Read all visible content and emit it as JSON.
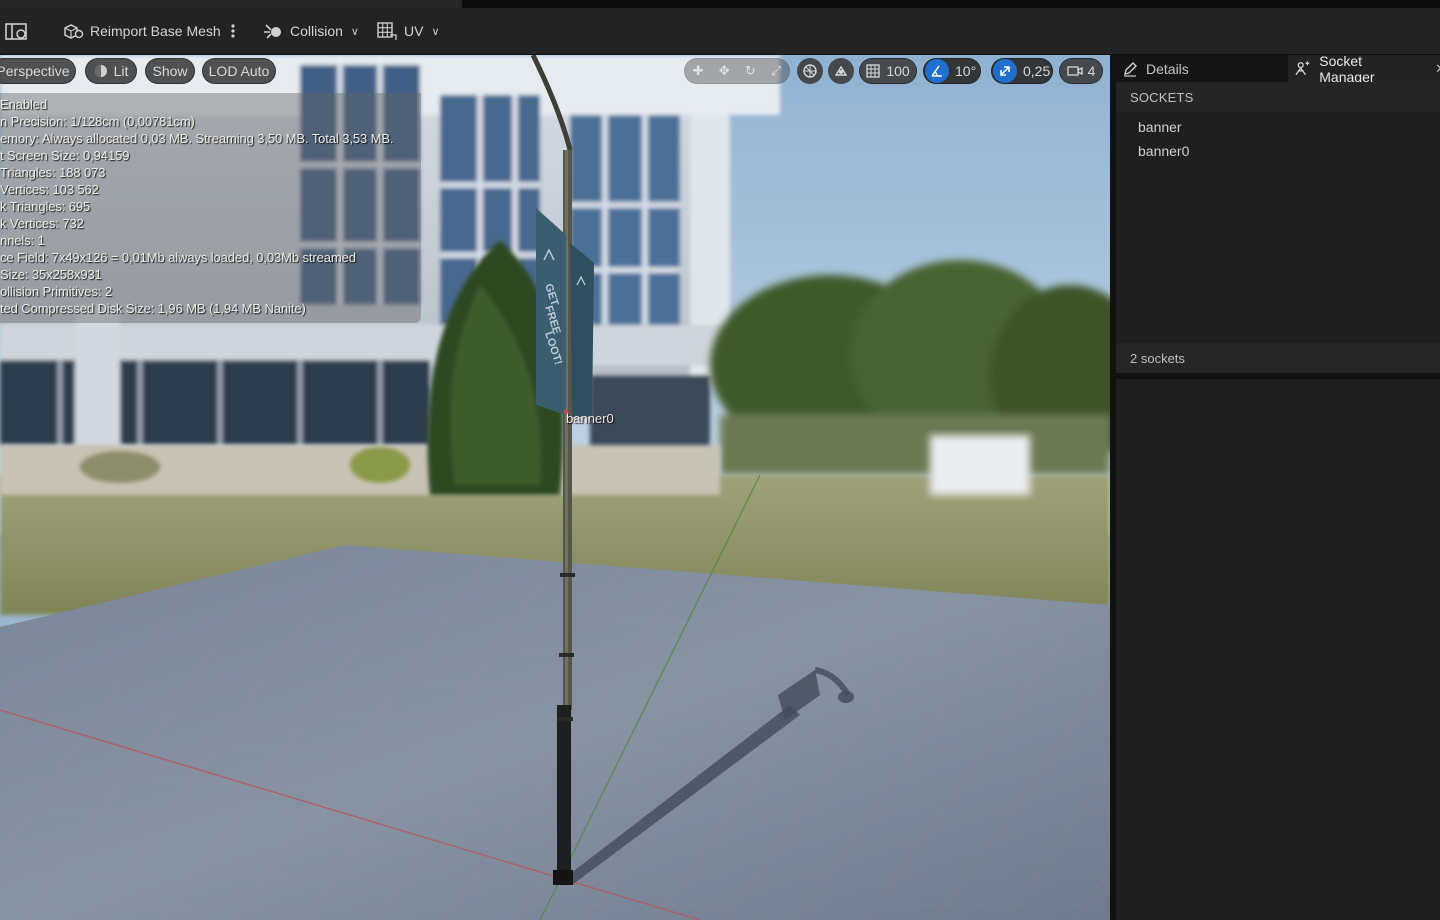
{
  "toolbar": {
    "reimport_label": "Reimport Base Mesh",
    "collision_label": "Collision",
    "uv_label": "UV",
    "icons": [
      "hide-panel-icon",
      "reimport-icon",
      "more-vert-icon",
      "collision-icon",
      "uv-grid-icon",
      "chevron-down-icon"
    ]
  },
  "viewport": {
    "perspective_label": "Perspective",
    "lit_label": "Lit",
    "show_label": "Show",
    "lod_label": "LOD Auto",
    "grid_snap_value": "100",
    "rotation_snap_value": "10°",
    "scale_snap_value": "0,25",
    "camera_speed_value": "4",
    "socket_label": "banner0",
    "stats": [
      "Enabled",
      "n Precision: 1/128cm (0,00781cm)",
      "emory: Always allocated 0,03 MB. Streaming 3,50 MB. Total 3,53 MB.",
      "t Screen Size: 0,94159",
      "Triangles: 188 073",
      "Vertices: 103 562",
      "k Triangles: 695",
      "k Vertices: 732",
      "nnels: 1",
      "ce Field: 7x49x126 = 0,01Mb always loaded, 0,03Mb streamed",
      "Size: 35x258x931",
      "ollision Primitives: 2",
      "ted Compressed Disk Size: 1,96 MB (1,94 MB Nanite)"
    ],
    "banner_text": [
      "GET",
      "FREE",
      "LOOT!"
    ]
  },
  "panel": {
    "details_tab": "Details",
    "socket_manager_tab": "Socket Manager",
    "sockets_header": "SOCKETS",
    "sockets": [
      "banner",
      "banner0"
    ],
    "socket_count": "2 sockets"
  },
  "colors": {
    "accent_blue": "#1f6fd1",
    "panel_bg": "#1b1b1b",
    "toolbar_bg": "#232323"
  }
}
